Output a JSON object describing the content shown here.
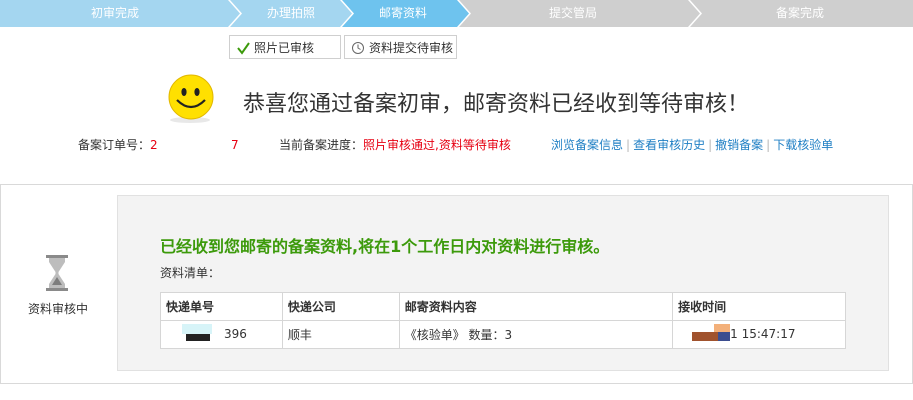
{
  "steps": [
    {
      "label": "初审完成",
      "state": "done"
    },
    {
      "label": "办理拍照",
      "state": "done"
    },
    {
      "label": "邮寄资料",
      "state": "current"
    },
    {
      "label": "提交管局",
      "state": "pending"
    },
    {
      "label": "备案完成",
      "state": "pending"
    }
  ],
  "colors": {
    "step_done": "#a4d6f0",
    "step_current": "#6ec3ee",
    "step_pending": "#cfcfcf",
    "green": "#3c9a0b",
    "red": "#e60012",
    "link": "#1f7fc4"
  },
  "subtabs": [
    {
      "icon": "checkmark-icon",
      "label": "照片已审核"
    },
    {
      "icon": "clock-icon",
      "label": "资料提交待审核"
    }
  ],
  "headline": "恭喜您通过备案初审，邮寄资料已经收到等待审核！",
  "order": {
    "label": "备案订单号：",
    "value_start": "2",
    "value_end": "7"
  },
  "progress": {
    "label": "当前备案进度：",
    "value": "照片审核通过,资料等待审核"
  },
  "links": [
    "浏览备案信息",
    "查看审核历史",
    "撤销备案",
    "下载核验单"
  ],
  "status": {
    "icon": "hourglass-icon",
    "label": "资料审核中"
  },
  "message": "已经收到您邮寄的备案资料,将在1个工作日内对资料进行审核。",
  "list_label": "资料清单：",
  "table": {
    "headers": [
      "快递单号",
      "快递公司",
      "邮寄资料内容",
      "接收时间"
    ],
    "rows": [
      {
        "tracking": "396",
        "company": "顺丰",
        "content": "《核验单》 数量：3",
        "time": "1 15:47:17"
      }
    ]
  }
}
